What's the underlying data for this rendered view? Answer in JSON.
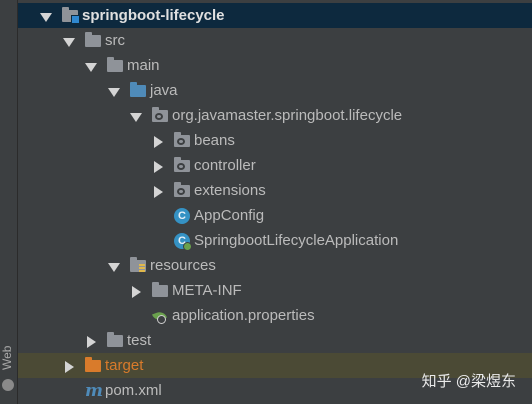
{
  "side_panel": {
    "label": "Web"
  },
  "project_tree": {
    "items": [
      {
        "label": "springboot-lifecycle",
        "state": "expanded",
        "icon": "module-folder-icon"
      },
      {
        "label": "src",
        "state": "expanded",
        "icon": "folder-icon"
      },
      {
        "label": "main",
        "state": "expanded",
        "icon": "folder-icon"
      },
      {
        "label": "java",
        "state": "expanded",
        "icon": "source-folder-icon"
      },
      {
        "label": "org.javamaster.springboot.lifecycle",
        "state": "expanded",
        "icon": "package-icon"
      },
      {
        "label": "beans",
        "state": "collapsed",
        "icon": "package-icon"
      },
      {
        "label": "controller",
        "state": "collapsed",
        "icon": "package-icon"
      },
      {
        "label": "extensions",
        "state": "collapsed",
        "icon": "package-icon"
      },
      {
        "label": "AppConfig",
        "state": "leaf",
        "icon": "class-icon"
      },
      {
        "label": "SpringbootLifecycleApplication",
        "state": "leaf",
        "icon": "spring-boot-class-icon"
      },
      {
        "label": "resources",
        "state": "expanded",
        "icon": "resources-folder-icon"
      },
      {
        "label": "META-INF",
        "state": "collapsed",
        "icon": "folder-icon"
      },
      {
        "label": "application.properties",
        "state": "leaf",
        "icon": "spring-properties-icon"
      },
      {
        "label": "test",
        "state": "collapsed",
        "icon": "folder-icon"
      },
      {
        "label": "target",
        "state": "collapsed",
        "icon": "excluded-folder-icon"
      },
      {
        "label": "pom.xml",
        "state": "leaf",
        "icon": "maven-icon"
      }
    ]
  },
  "colors": {
    "background": "#3c3f41",
    "root_selection": "#0d293e",
    "excluded_highlight": "#4b4a35",
    "excluded_text": "#d97b2b"
  },
  "watermark": {
    "text": "知乎 @梁煜东"
  }
}
